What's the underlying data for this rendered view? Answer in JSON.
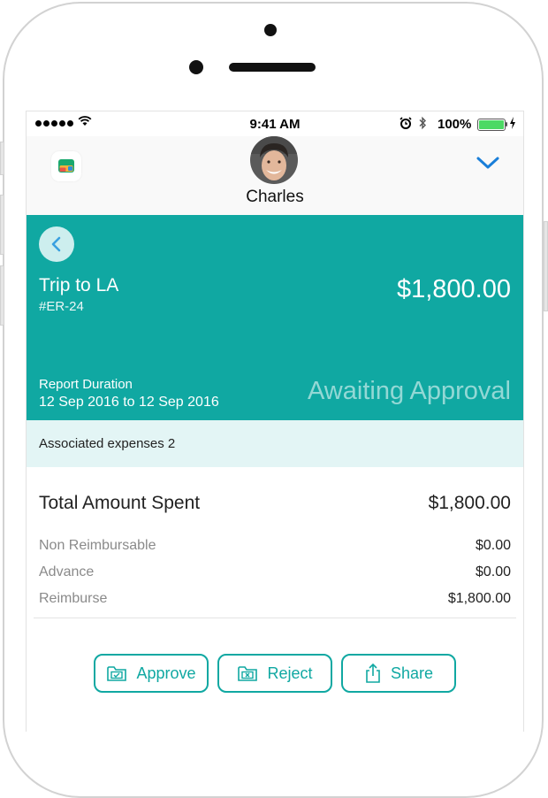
{
  "status_bar": {
    "time": "9:41 AM",
    "battery": "100%"
  },
  "nav": {
    "user_name": "Charles"
  },
  "report": {
    "title": "Trip to LA",
    "id": "#ER-24",
    "amount": "$1,800.00",
    "duration_label": "Report Duration",
    "duration_value": "12 Sep 2016 to 12 Sep 2016",
    "status": "Awaiting Approval"
  },
  "associated": {
    "text": "Associated expenses 2"
  },
  "summary": {
    "total_label": "Total Amount Spent",
    "total_value": "$1,800.00",
    "rows": [
      {
        "label": "Non Reimbursable",
        "value": "$0.00"
      },
      {
        "label": "Advance",
        "value": "$0.00"
      },
      {
        "label": "Reimburse",
        "value": "$1,800.00"
      }
    ]
  },
  "actions": {
    "approve": "Approve",
    "reject": "Reject",
    "share": "Share"
  },
  "colors": {
    "accent": "#10a8a2",
    "assoc_bg": "#e3f5f5",
    "battery": "#4cd964",
    "chevron": "#1a7fd9"
  }
}
